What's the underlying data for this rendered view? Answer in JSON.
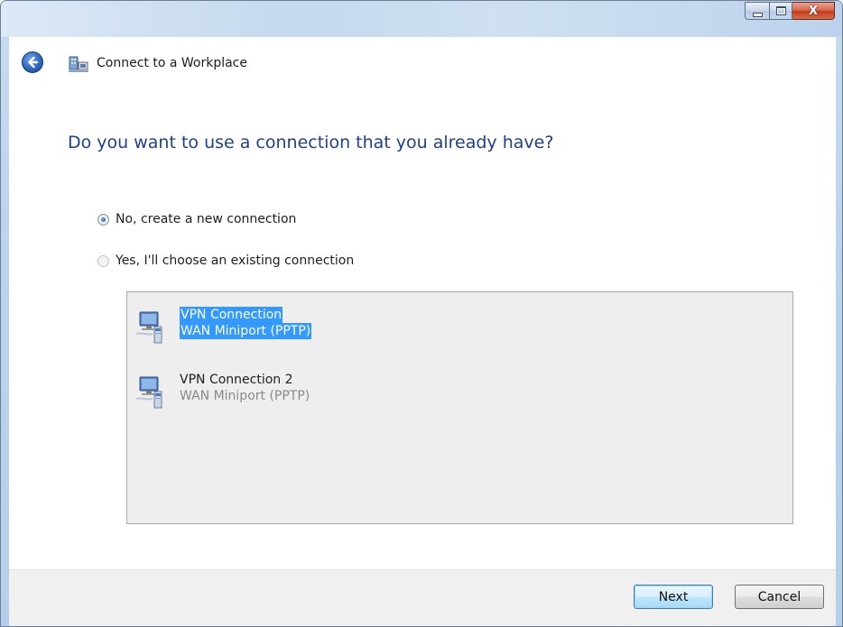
{
  "window": {
    "title": "Connect to a Workplace",
    "controls": {
      "minimize_icon": "minimize-icon",
      "maximize_icon": "maximize-icon",
      "close_glyph": "X"
    },
    "colors": {
      "heading": "#1f3f94",
      "selection": "#3399ff"
    }
  },
  "page": {
    "heading": "Do you want to use a connection that you already have?",
    "options": [
      {
        "label": "No, create a new connection",
        "selected": true
      },
      {
        "label": "Yes, I'll choose an existing connection",
        "selected": false
      }
    ],
    "connections": [
      {
        "name": "VPN Connection",
        "device": "WAN Miniport (PPTP)",
        "selected": true,
        "icon": "network-computer-icon"
      },
      {
        "name": "VPN Connection 2",
        "device": "WAN Miniport (PPTP)",
        "selected": false,
        "icon": "network-computer-icon"
      }
    ]
  },
  "footer": {
    "next_label": "Next",
    "cancel_label": "Cancel"
  }
}
